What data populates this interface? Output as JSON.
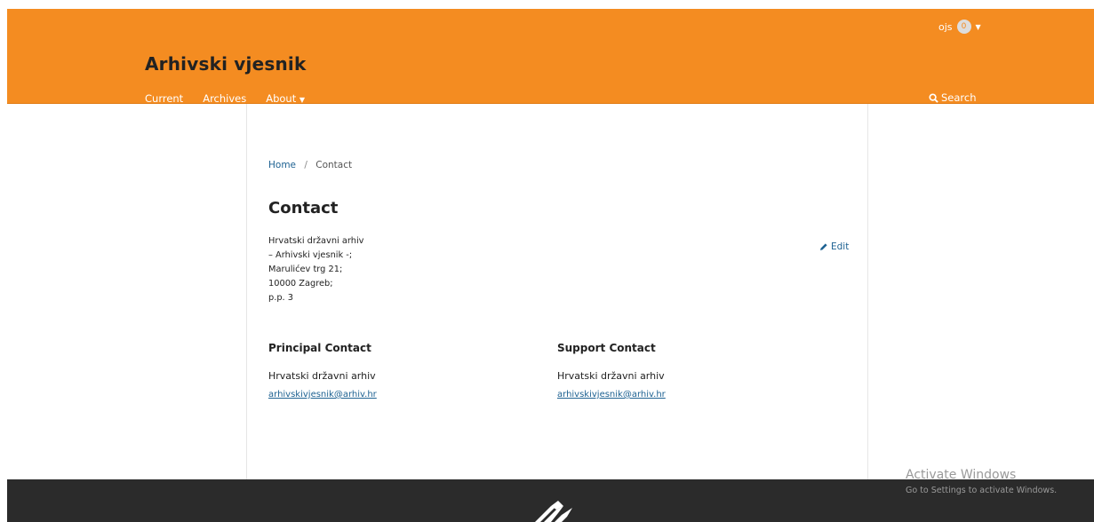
{
  "header": {
    "site_title": "Arhivski vjesnik",
    "user": {
      "name": "ojs",
      "notifications": "0"
    },
    "nav": [
      "Current",
      "Archives",
      "About"
    ],
    "search_label": "Search",
    "accent_color": "#f48c21"
  },
  "breadcrumb": {
    "home": "Home",
    "separator": "/",
    "current": "Contact"
  },
  "page": {
    "title": "Contact",
    "edit_label": "Edit",
    "address": [
      "Hrvatski državni arhiv",
      "– Arhivski vjesnik -;",
      "Marulićev trg 21;",
      "10000 Zagreb;",
      "p.p. 3"
    ]
  },
  "principal": {
    "heading": "Principal Contact",
    "name": "Hrvatski državni arhiv",
    "email": "arhivskivjesnik@arhiv.hr"
  },
  "support": {
    "heading": "Support Contact",
    "name": "Hrvatski državni arhiv",
    "email": "arhivskivjesnik@arhiv.hr"
  },
  "watermark": {
    "line1": "Activate Windows",
    "line2": "Go to Settings to activate Windows."
  },
  "icons": {
    "search": "search-icon",
    "edit": "pencil-icon",
    "dropdown": "caret-down-icon",
    "footer_logo": "ojs-logo-icon"
  }
}
